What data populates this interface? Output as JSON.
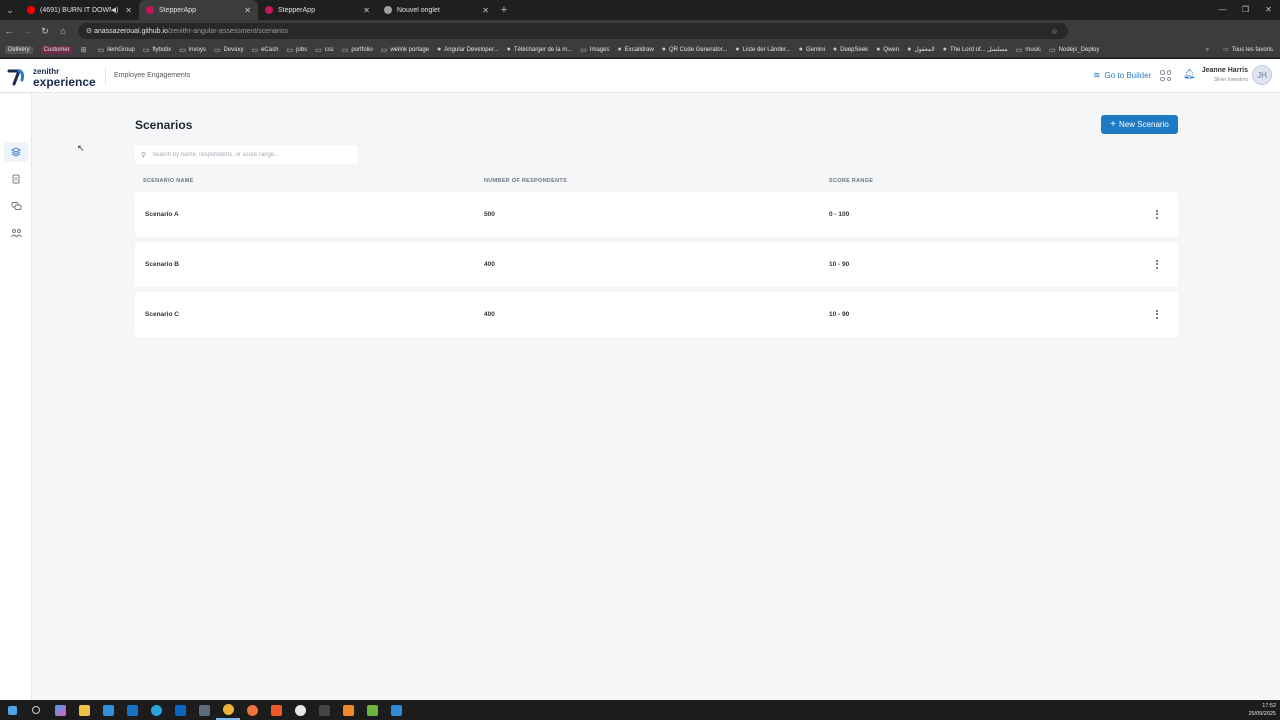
{
  "browser": {
    "tabs": [
      {
        "title": "(4691) BURN IT DOWN (O",
        "active": false,
        "favicon_color": "#ff0000",
        "audio": true
      },
      {
        "title": "StepperApp",
        "active": true,
        "favicon_color": "#c2185b",
        "audio": false
      },
      {
        "title": "StepperApp",
        "active": false,
        "favicon_color": "#c2185b",
        "audio": false
      },
      {
        "title": "Nouvel onglet",
        "active": false,
        "favicon_color": "#9e9e9e",
        "audio": false
      }
    ],
    "address": {
      "host": "anassazeroual.github.io",
      "path": "/zenithr-angular-assessment/scenarios"
    },
    "bookmarks": [
      {
        "label": "Delivery",
        "icon": "tag"
      },
      {
        "label": "Customer",
        "icon": "tag"
      },
      {
        "label": "",
        "icon": "apps-icon"
      },
      {
        "label": "ilemGroup",
        "icon": "folder-icon"
      },
      {
        "label": "flybotix",
        "icon": "folder-icon"
      },
      {
        "label": "invoys",
        "icon": "folder-icon"
      },
      {
        "label": "Devaxy",
        "icon": "folder-icon"
      },
      {
        "label": "eCash",
        "icon": "folder-icon"
      },
      {
        "label": "jobs",
        "icon": "folder-icon"
      },
      {
        "label": "css",
        "icon": "folder-icon"
      },
      {
        "label": "portfolio",
        "icon": "folder-icon"
      },
      {
        "label": "welink portage",
        "icon": "folder-icon"
      },
      {
        "label": "Angular Developer...",
        "icon": "site-icon"
      },
      {
        "label": "Télécharger de la m...",
        "icon": "site-icon"
      },
      {
        "label": "Images",
        "icon": "folder-icon"
      },
      {
        "label": "Excalidraw",
        "icon": "site-icon"
      },
      {
        "label": "QR Code Generator...",
        "icon": "site-icon"
      },
      {
        "label": "Liste der Länder...",
        "icon": "site-icon"
      },
      {
        "label": "Gemini",
        "icon": "site-icon"
      },
      {
        "label": "DeepSeek",
        "icon": "site-icon"
      },
      {
        "label": "Qwen",
        "icon": "site-icon"
      },
      {
        "label": "المعقول",
        "icon": "site-icon"
      },
      {
        "label": "The Lord of... مسلسل",
        "icon": "site-icon"
      },
      {
        "label": "music",
        "icon": "folder-icon"
      },
      {
        "label": "Nodejs_Deploy",
        "icon": "folder-icon"
      }
    ],
    "bookmarks_all": "Tous les favoris"
  },
  "app": {
    "logo": {
      "line1": "zenithr",
      "line2": "experience"
    },
    "section_title": "Employee Engagements",
    "go_to_builder": "Go to Builder",
    "user": {
      "name": "Jeanne Harris",
      "role": "Silver Investors",
      "initials": "JH"
    }
  },
  "page": {
    "title": "Scenarios",
    "new_button": "New Scenario",
    "search_placeholder": "Search by name, respondents, or score range...",
    "columns": [
      "SCENARIO NAME",
      "NUMBER OF RESPONDENTS",
      "SCORE RANGE"
    ],
    "rows": [
      {
        "name": "Scenario A",
        "respondents": "500",
        "score": "0 - 100"
      },
      {
        "name": "Scenario B",
        "respondents": "400",
        "score": "10 - 90"
      },
      {
        "name": "Scenario C",
        "respondents": "400",
        "score": "10 - 90"
      }
    ]
  },
  "taskbar": {
    "time": "17:52",
    "date": "25/09/2025"
  },
  "colors": {
    "accent": "#1f7ac4",
    "brand_dark": "#1b2a4e"
  }
}
